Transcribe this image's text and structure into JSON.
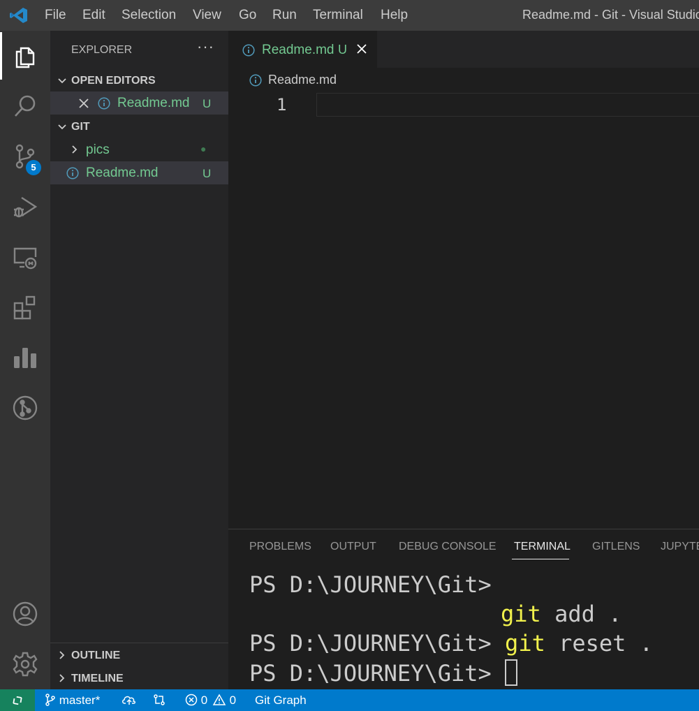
{
  "titlebar": {
    "menu": [
      "File",
      "Edit",
      "Selection",
      "View",
      "Go",
      "Run",
      "Terminal",
      "Help"
    ],
    "window_title": "Readme.md - Git - Visual Studio"
  },
  "activitybar": {
    "items": [
      "explorer-icon",
      "search-icon",
      "source-control-icon",
      "run-debug-icon",
      "remote-explorer-icon",
      "extensions-icon",
      "chart-icon",
      "git-graph-icon",
      "account-icon",
      "settings-gear-icon"
    ],
    "scm_badge": "5"
  },
  "sidebar": {
    "header": "EXPLORER",
    "more": "···",
    "open_editors": {
      "title": "OPEN EDITORS",
      "items": [
        {
          "name": "Readme.md",
          "status": "U"
        }
      ]
    },
    "workspace": {
      "title": "GIT",
      "items": [
        {
          "name": "pics",
          "type": "folder",
          "status": "●"
        },
        {
          "name": "Readme.md",
          "type": "file",
          "status": "U"
        }
      ]
    },
    "outline": "OUTLINE",
    "timeline": "TIMELINE"
  },
  "editor": {
    "tab": {
      "label": "Readme.md",
      "status": "U"
    },
    "breadcrumb": "Readme.md",
    "line_number": "1"
  },
  "panel": {
    "tabs": [
      "PROBLEMS",
      "OUTPUT",
      "DEBUG CONSOLE",
      "TERMINAL",
      "GITLENS",
      "JUPYTER"
    ],
    "active_tab": "TERMINAL",
    "terminal": {
      "prompt": "PS D:\\JOURNEY\\Git>",
      "cmd1_git": "git",
      "cmd1_rest": " add .",
      "cmd2_git": "git",
      "cmd2_rest": " reset ."
    }
  },
  "statusbar": {
    "branch": "master*",
    "errors": "0",
    "warnings": "0",
    "git_graph": "Git Graph"
  },
  "colors": {
    "accent": "#007acc",
    "remote": "#16825d",
    "git_untracked": "#73c991",
    "terminal_yellow": "#f1f14c"
  }
}
